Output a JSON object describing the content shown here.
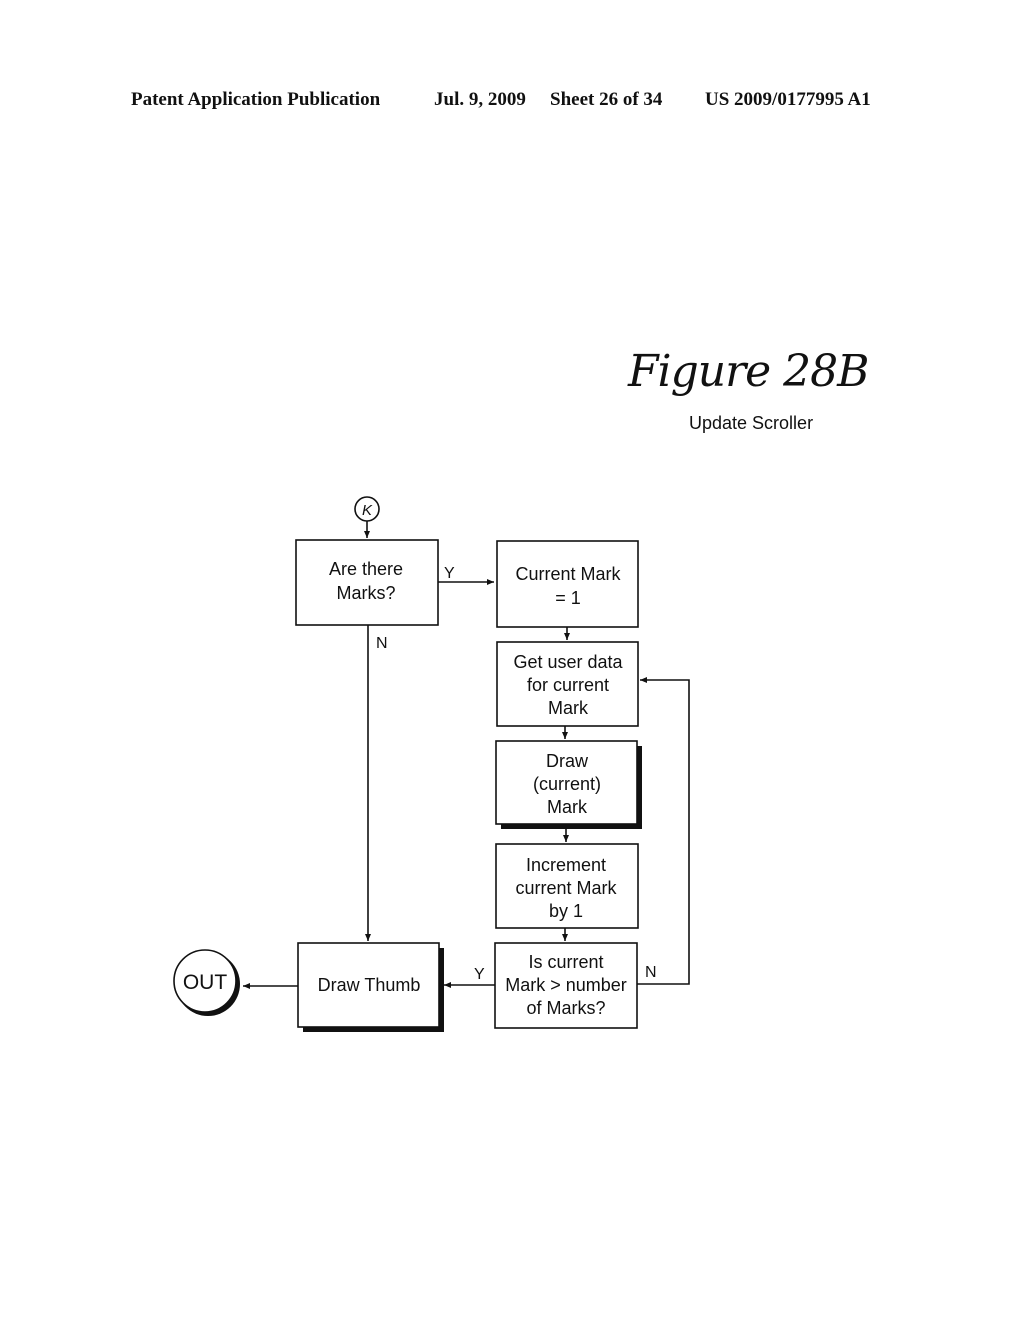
{
  "header": {
    "publication": "Patent Application Publication",
    "date": "Jul. 9, 2009",
    "sheet": "Sheet 26 of 34",
    "number": "US 2009/0177995 A1"
  },
  "figure": {
    "title": "Figure 28B",
    "subtitle": "Update Scroller"
  },
  "flowchart": {
    "connector_in": "K",
    "connector_out": "OUT",
    "nodes": {
      "are_there_marks": [
        "Are there",
        "Marks?"
      ],
      "current_mark_1": [
        "Current Mark",
        "= 1"
      ],
      "get_user_data": [
        "Get user data",
        "for current",
        "Mark"
      ],
      "draw_mark": [
        "Draw",
        "(current)",
        "Mark"
      ],
      "increment": [
        "Increment",
        "current Mark",
        "by 1"
      ],
      "is_greater": [
        "Is current",
        "Mark > number",
        "of Marks?"
      ],
      "draw_thumb": [
        "Draw Thumb"
      ]
    },
    "edges": {
      "marks_yes": "Y",
      "marks_no": "N",
      "greater_yes": "Y",
      "greater_no": "N"
    }
  }
}
